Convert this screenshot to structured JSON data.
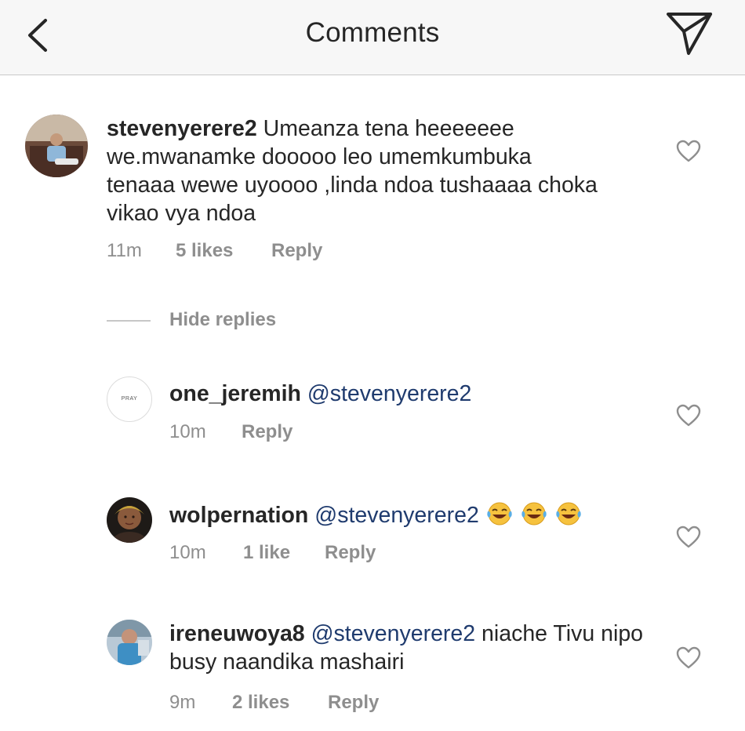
{
  "header": {
    "title": "Comments",
    "back_icon": "chevron-left-icon",
    "send_icon": "paper-plane-icon"
  },
  "comments": [
    {
      "username": "stevenyerere2",
      "body": " Umeanza tena heeeeeee we.mwanamke dooooo leo umemkumbuka tenaaa wewe uyoooo ,linda ndoa tushaaaa choka vikao vya ndoa",
      "time": "11m",
      "likes": "5 likes",
      "reply": "Reply"
    }
  ],
  "hide_replies": "Hide replies",
  "replies": [
    {
      "username": "one_jeremih",
      "mention": "@stevenyerere2",
      "body": "",
      "time": "10m",
      "likes": "",
      "reply": "Reply",
      "avatar_text": "PRAY"
    },
    {
      "username": "wolpernation",
      "mention": "@stevenyerere2",
      "body": "",
      "emoji": "face-with-tears-of-joy x3",
      "time": "10m",
      "likes": "1 like",
      "reply": "Reply"
    },
    {
      "username": "ireneuwoya8",
      "mention": "@stevenyerere2",
      "body": " niache Tivu nipo busy naandika mashairi",
      "time": "9m",
      "likes": "2 likes",
      "reply": "Reply"
    }
  ],
  "colors": {
    "header_bg": "#f7f7f7",
    "text": "#262626",
    "muted": "#8e8e8e",
    "mention": "#1f3b6e"
  }
}
